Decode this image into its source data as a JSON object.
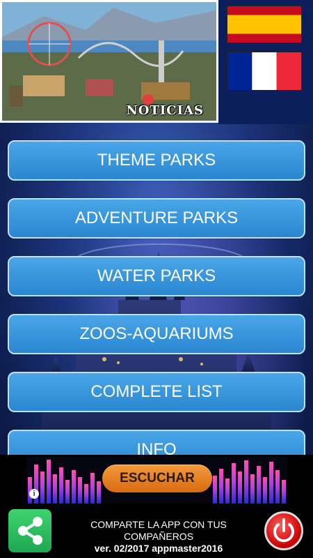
{
  "header": {
    "news_label": "NOTICIAS",
    "flags": [
      "spanish-flag",
      "french-flag"
    ]
  },
  "menu": [
    {
      "label": "THEME PARKS"
    },
    {
      "label": "ADVENTURE PARKS"
    },
    {
      "label": "WATER PARKS"
    },
    {
      "label": "ZOOS-AQUARIUMS"
    },
    {
      "label": "COMPLETE LIST"
    },
    {
      "label": "INFO"
    }
  ],
  "ad": {
    "button_label": "ESCUCHAR",
    "info_icon": "i"
  },
  "footer": {
    "line1": "COMPARTE LA APP CON TUS COMPAÑEROS",
    "line2": "ver. 02/2017 appmaster2016"
  },
  "colors": {
    "button_blue": "#3a97dd",
    "button_border": "#bfe2fb",
    "share_green": "#2cbf5e",
    "power_red": "#d10000",
    "escuchar_orange": "#e8822a"
  }
}
